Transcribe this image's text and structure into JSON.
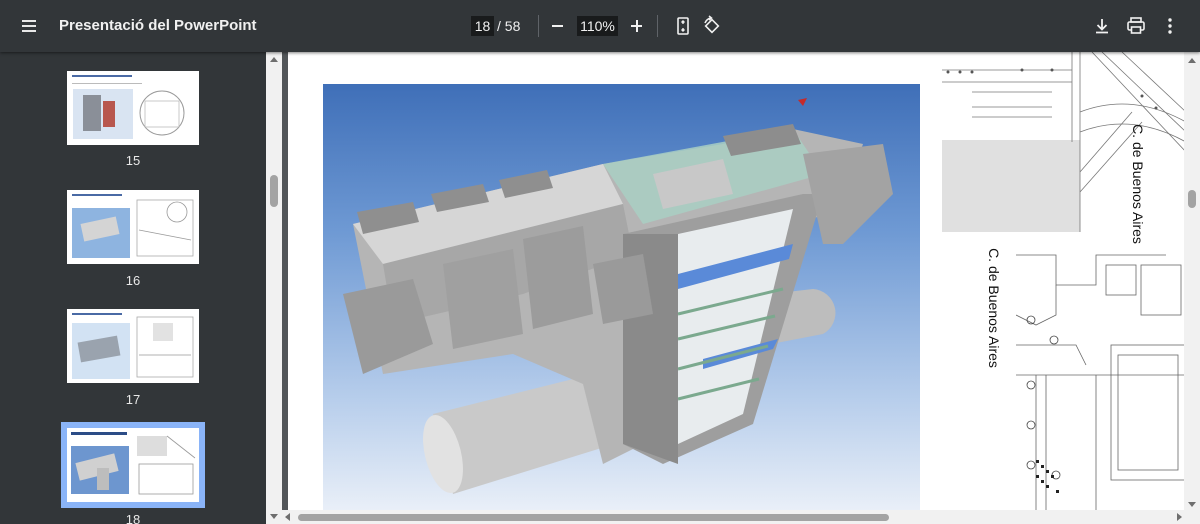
{
  "toolbar": {
    "title": "Presentació del PowerPoint",
    "current_page": "18",
    "total_pages": "/ 58",
    "zoom": "110%"
  },
  "sidebar": {
    "thumbnails": [
      {
        "number": "15",
        "title": "Tipologia constructiva estacions"
      },
      {
        "number": "16",
        "title": "Estació de Plaça Espanya"
      },
      {
        "number": "17",
        "title": "Estació d'Hospital Clínic"
      },
      {
        "number": "18",
        "title": "Estació de Francesc Macià",
        "selected": true
      }
    ]
  },
  "document": {
    "street_label_1": "C. de Buenos Aires",
    "street_label_2": "C. de Buenos Aires"
  },
  "colors": {
    "toolbar_bg": "#323639",
    "viewer_bg": "#525659",
    "selection": "#8ab4f8"
  }
}
